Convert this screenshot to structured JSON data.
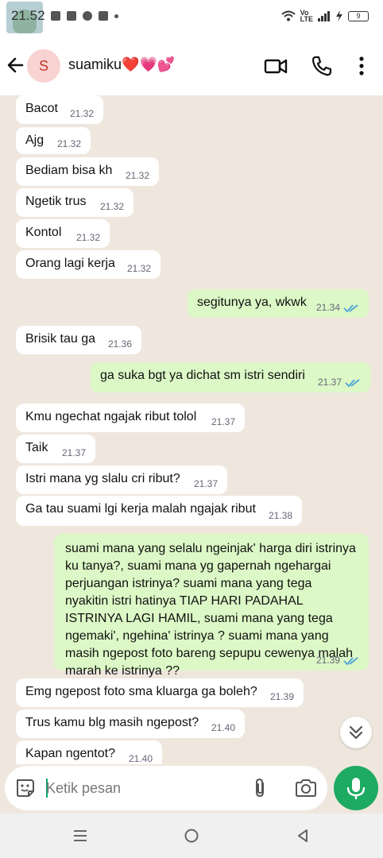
{
  "status_bar": {
    "time": "21.52",
    "network_label": "Vo\nLTE",
    "battery": "9"
  },
  "header": {
    "avatar_letter": "S",
    "contact_name": "suamiku❤️💗💕"
  },
  "messages": [
    {
      "dir": "in",
      "text": "Bacot",
      "time": "21.32"
    },
    {
      "dir": "in",
      "text": "Ajg",
      "time": "21.32"
    },
    {
      "dir": "in",
      "text": "Bediam bisa kh",
      "time": "21.32"
    },
    {
      "dir": "in",
      "text": "Ngetik trus",
      "time": "21.32"
    },
    {
      "dir": "in",
      "text": "Kontol",
      "time": "21.32"
    },
    {
      "dir": "in",
      "text": "Orang lagi kerja",
      "time": "21.32"
    },
    {
      "dir": "out",
      "text": "segitunya ya, wkwk",
      "time": "21.34"
    },
    {
      "dir": "in",
      "text": "Brisik tau ga",
      "time": "21.36"
    },
    {
      "dir": "out",
      "text": "ga suka bgt ya dichat sm istri sendiri",
      "time": "21.37"
    },
    {
      "dir": "in",
      "text": "Kmu ngechat ngajak ribut tolol",
      "time": "21.37"
    },
    {
      "dir": "in",
      "text": "Taik",
      "time": "21.37"
    },
    {
      "dir": "in",
      "text": "Istri mana yg slalu cri ribut?",
      "time": "21.37"
    },
    {
      "dir": "in",
      "text": "Ga tau suami lgi kerja malah ngajak ribut",
      "time": "21.38"
    },
    {
      "dir": "out",
      "text": "suami mana yang selalu ngeinjak' harga diri istrinya ku tanya?, suami mana yg gapernah ngehargai perjuangan istrinya? suami mana yang tega nyakitin istri hatinya TIAP HARI PADAHAL ISTRINYA LAGI HAMIL, suami mana yang tega ngemaki', ngehina' istrinya ? suami mana yang masih ngepost foto bareng sepupu cewenya malah marah ke istrinya ??",
      "time": "21.39"
    },
    {
      "dir": "in",
      "text": "Emg ngepost foto sma kluarga ga boleh?",
      "time": "21.39"
    },
    {
      "dir": "in",
      "text": "Trus kamu blg masih ngepost?",
      "time": "21.40"
    },
    {
      "dir": "in",
      "text": "Kapan ngentot?",
      "time": "21.40"
    }
  ],
  "composer": {
    "placeholder": "Ketik pesan"
  },
  "colors": {
    "incoming": "#ffffff",
    "outgoing": "#dcf8c6",
    "accent": "#1daa61",
    "read_ticks": "#4fa3d8"
  }
}
